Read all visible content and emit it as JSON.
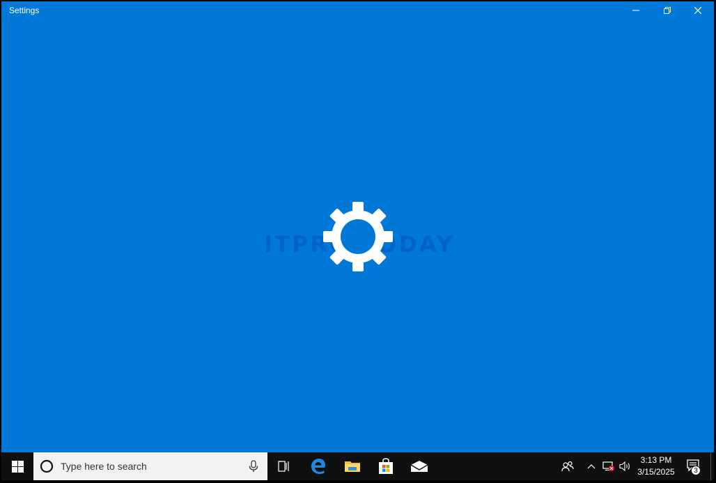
{
  "window": {
    "title": "Settings",
    "background": "#0078d7",
    "splash_icon": "gear-icon",
    "watermark": "ITPRO TODAY"
  },
  "caption_buttons": {
    "minimize_icon": "minimize-icon",
    "maximize_icon": "restore-icon",
    "close_icon": "close-icon"
  },
  "taskbar": {
    "start_icon": "windows-logo-icon",
    "search": {
      "placeholder": "Type here to search",
      "cortana_icon": "cortana-circle-icon",
      "mic_icon": "microphone-icon"
    },
    "pinned": [
      {
        "name": "Task View",
        "icon": "task-view-icon"
      },
      {
        "name": "Microsoft Edge",
        "icon": "edge-icon"
      },
      {
        "name": "File Explorer",
        "icon": "folder-icon"
      },
      {
        "name": "Microsoft Store",
        "icon": "store-bag-icon"
      },
      {
        "name": "Mail",
        "icon": "mail-icon"
      }
    ],
    "tray": {
      "people_icon": "people-icon",
      "chevron_icon": "chevron-up-icon",
      "network_icon": "network-disconnected-icon",
      "volume_icon": "volume-icon",
      "time": "3:13 PM",
      "date": "3/15/2025",
      "action_center_icon": "action-center-icon",
      "notification_count": "3"
    }
  }
}
